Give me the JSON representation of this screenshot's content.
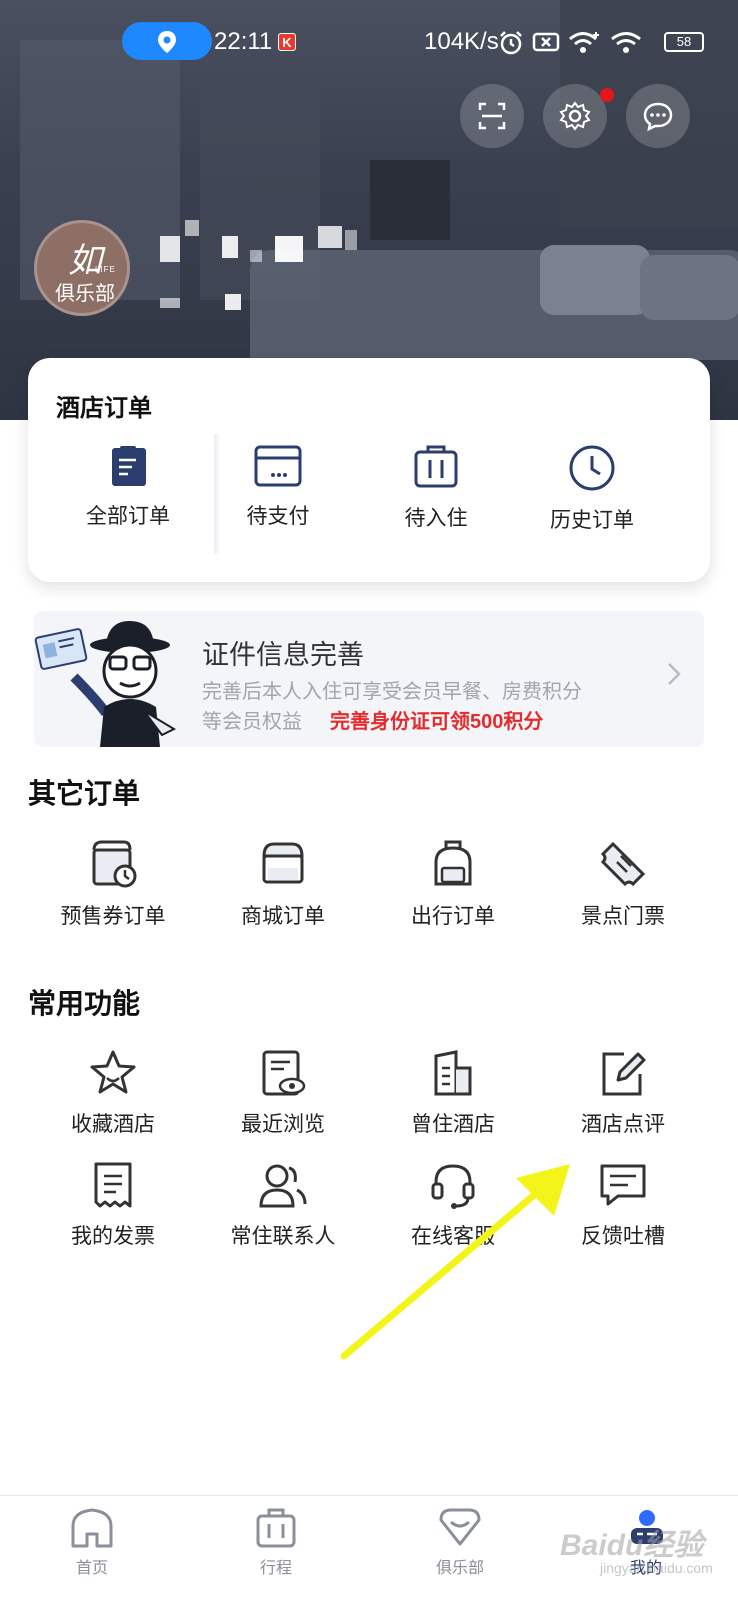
{
  "status_bar": {
    "time": "22:11",
    "k_badge": "K",
    "net_speed": "104K/s",
    "battery": "58"
  },
  "header": {
    "club_logo_text": "如",
    "club_logo_sub": "LIFE",
    "club_logo_name": "俱乐部"
  },
  "hotel_orders": {
    "title": "酒店订单",
    "items": [
      {
        "label": "全部订单",
        "icon": "document-icon"
      },
      {
        "label": "待支付",
        "icon": "wallet-icon"
      },
      {
        "label": "待入住",
        "icon": "luggage-icon"
      },
      {
        "label": "历史订单",
        "icon": "clock-icon"
      }
    ]
  },
  "id_banner": {
    "title": "证件信息完善",
    "desc_line1": "完善后本人入住可享受会员早餐、房费积分",
    "desc_line2": "等会员权益",
    "promo": "完善身份证可领500积分"
  },
  "other_orders": {
    "title": "其它订单",
    "items": [
      {
        "label": "预售券订单",
        "icon": "presale-voucher-icon"
      },
      {
        "label": "商城订单",
        "icon": "shop-icon"
      },
      {
        "label": "出行订单",
        "icon": "backpack-icon"
      },
      {
        "label": "景点门票",
        "icon": "ticket-icon"
      }
    ]
  },
  "common_functions": {
    "title": "常用功能",
    "items": [
      {
        "label": "收藏酒店",
        "icon": "star-icon"
      },
      {
        "label": "最近浏览",
        "icon": "browse-history-icon"
      },
      {
        "label": "曾住酒店",
        "icon": "building-icon"
      },
      {
        "label": "酒店点评",
        "icon": "edit-review-icon"
      },
      {
        "label": "我的发票",
        "icon": "invoice-icon"
      },
      {
        "label": "常住联系人",
        "icon": "contacts-icon"
      },
      {
        "label": "在线客服",
        "icon": "headset-icon"
      },
      {
        "label": "反馈吐槽",
        "icon": "feedback-icon"
      }
    ]
  },
  "bottom_nav": {
    "items": [
      {
        "label": "首页",
        "icon": "home-icon"
      },
      {
        "label": "行程",
        "icon": "suitcase-icon"
      },
      {
        "label": "俱乐部",
        "icon": "club-icon"
      },
      {
        "label": "我的",
        "icon": "profile-icon"
      }
    ]
  },
  "watermark": {
    "text": "Baidu经验",
    "sub": "jingyan.baidu.com"
  },
  "colors": {
    "accent": "#2c3e70",
    "promo_red": "#e52b2b",
    "nav_blue": "#1e88ff"
  }
}
